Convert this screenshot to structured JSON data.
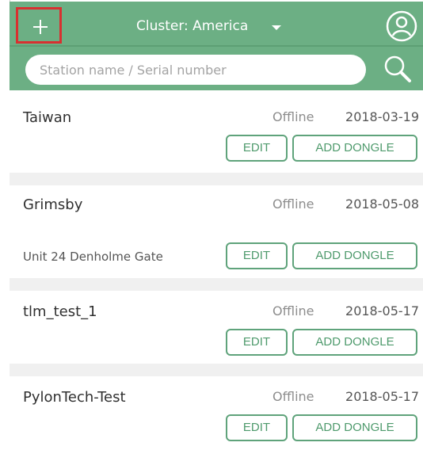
{
  "header": {
    "cluster_label": "Cluster: America",
    "add_icon": "plus-icon",
    "user_icon": "user-icon",
    "search_icon": "search-icon",
    "accent_color": "#6caf84",
    "highlight_color": "#d83030"
  },
  "search": {
    "placeholder": "Station name / Serial number",
    "value": ""
  },
  "buttons": {
    "edit_label": "EDIT",
    "add_dongle_label": "ADD DONGLE"
  },
  "stations": [
    {
      "name": "Taiwan",
      "status": "Offline",
      "date": "2018-03-19",
      "address": ""
    },
    {
      "name": "Grimsby",
      "status": "Offline",
      "date": "2018-05-08",
      "address": "Unit 24 Denholme Gate"
    },
    {
      "name": "tlm_test_1",
      "status": "Offline",
      "date": "2018-05-17",
      "address": ""
    },
    {
      "name": "PylonTech-Test",
      "status": "Offline",
      "date": "2018-05-17",
      "address": ""
    }
  ]
}
